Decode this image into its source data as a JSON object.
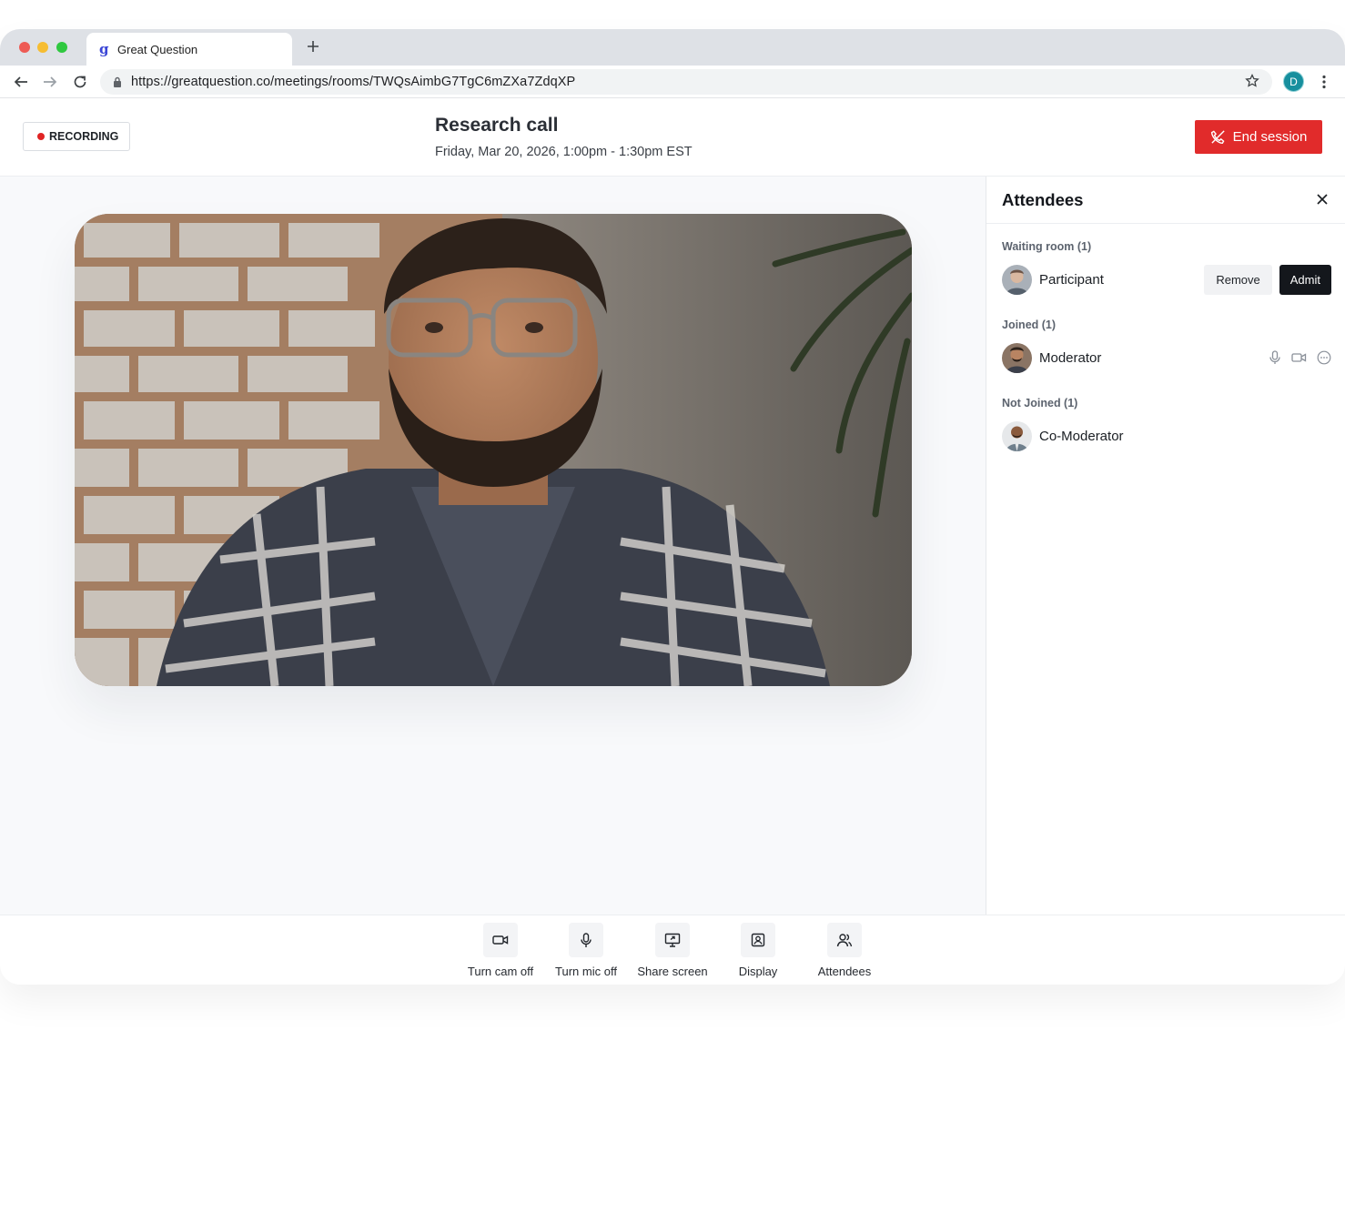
{
  "browser": {
    "tab_title": "Great Question",
    "tab_favicon": "g",
    "url": "https://greatquestion.co/meetings/rooms/TWQsAimbG7TgC6mZXa7ZdqXP",
    "profile_initial": "D"
  },
  "header": {
    "recording_label": "RECORDING",
    "title": "Research call",
    "datetime": "Friday, Mar 20, 2026, 1:00pm - 1:30pm EST",
    "end_session_label": "End session"
  },
  "attendees": {
    "title": "Attendees",
    "waiting": {
      "label": "Waiting room (1)",
      "people": [
        {
          "name": "Participant",
          "remove_label": "Remove",
          "admit_label": "Admit"
        }
      ]
    },
    "joined": {
      "label": "Joined (1)",
      "people": [
        {
          "name": "Moderator"
        }
      ]
    },
    "not_joined": {
      "label": "Not Joined (1)",
      "people": [
        {
          "name": "Co-Moderator"
        }
      ]
    }
  },
  "controls": [
    {
      "label": "Turn cam off",
      "icon": "video-camera-icon"
    },
    {
      "label": "Turn mic off",
      "icon": "microphone-icon"
    },
    {
      "label": "Share screen",
      "icon": "share-screen-icon"
    },
    {
      "label": "Display",
      "icon": "display-icon"
    },
    {
      "label": "Attendees",
      "icon": "users-icon"
    }
  ],
  "colors": {
    "end_session": "#e12b2b",
    "recording_dot": "#e02424",
    "admit_button": "#14171c",
    "profile": "#178f9e"
  }
}
